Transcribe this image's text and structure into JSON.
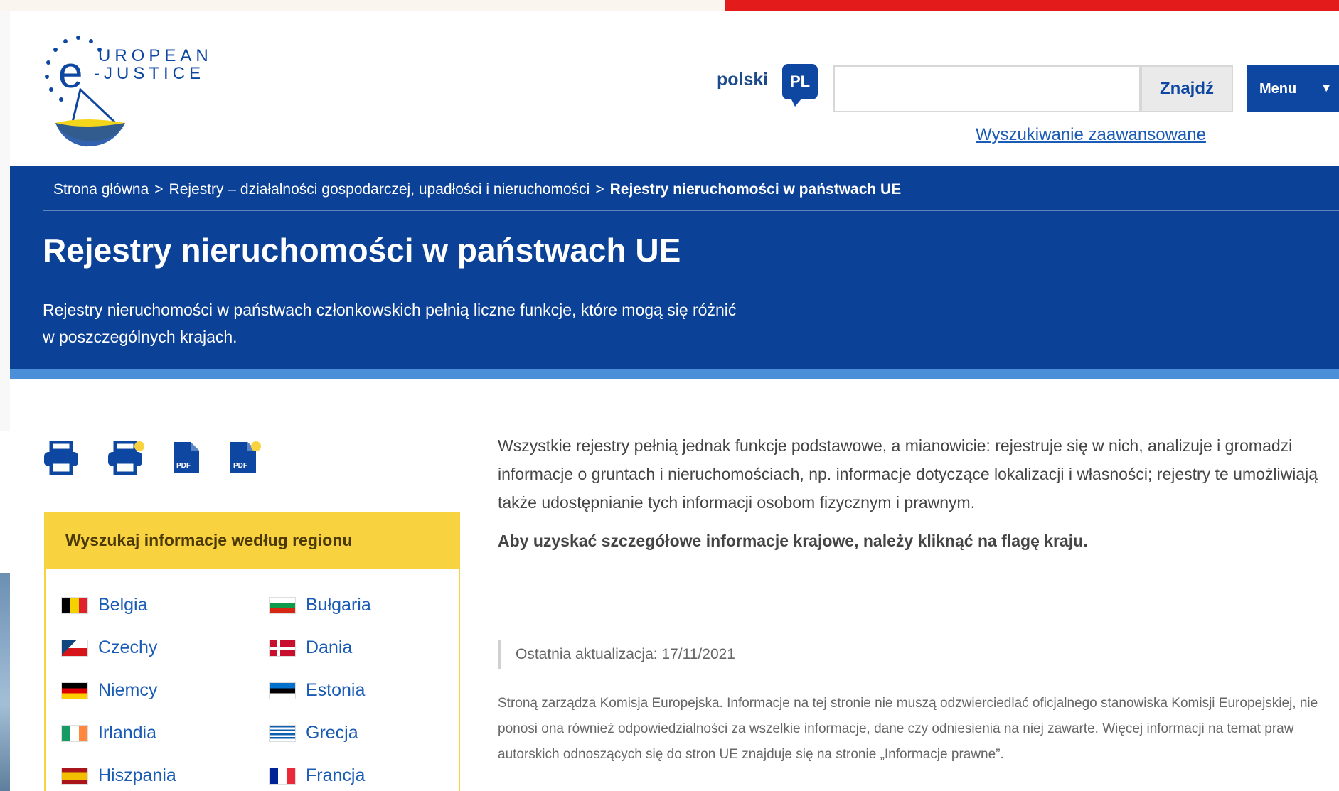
{
  "header": {
    "logo_alt": "European e-Justice",
    "logo_text_top": "UROPEAN",
    "logo_text_bottom": "-JUSTICE",
    "logo_letter": "e",
    "language_label": "polski",
    "language_code": "PL",
    "search_placeholder": "",
    "search_button": "Znajdź",
    "menu_button": "Menu",
    "menu_caret": "▼",
    "advanced_search": "Wyszukiwanie zaawansowane"
  },
  "breadcrumb": {
    "items": [
      "Strona główna",
      "Rejestry – działalności gospodarczej, upadłości i nieruchomości",
      "Rejestry nieruchomości w państwach UE"
    ],
    "separator": ">"
  },
  "page": {
    "title": "Rejestry nieruchomości w państwach UE",
    "subtitle_line1": "Rejestry nieruchomości w państwach członkowskich pełnią liczne funkcje, które mogą się różnić",
    "subtitle_line2": "w poszczególnych krajach."
  },
  "tools": {
    "print": "print-icon",
    "print_selected": "print-selection-icon",
    "pdf": "pdf-icon",
    "pdf_selected": "pdf-selection-icon"
  },
  "region": {
    "heading": "Wyszukaj informacje według regionu",
    "countries": [
      {
        "name": "Belgia",
        "colors": [
          "#000000",
          "#f6d100",
          "#e0232b"
        ],
        "dir": "v"
      },
      {
        "name": "Bułgaria",
        "colors": [
          "#ffffff",
          "#0d9b49",
          "#d62612"
        ],
        "dir": "h"
      },
      {
        "name": "Czechy",
        "colors": [
          "#ffffff",
          "#d7141a",
          "#11457e"
        ],
        "dir": "cz"
      },
      {
        "name": "Dania",
        "colors": [
          "#c8102e",
          "#ffffff"
        ],
        "dir": "dk"
      },
      {
        "name": "Niemcy",
        "colors": [
          "#000000",
          "#dd0000",
          "#ffce00"
        ],
        "dir": "h"
      },
      {
        "name": "Estonia",
        "colors": [
          "#0072ce",
          "#000000",
          "#ffffff"
        ],
        "dir": "h"
      },
      {
        "name": "Irlandia",
        "colors": [
          "#169b62",
          "#ffffff",
          "#ff883e"
        ],
        "dir": "v"
      },
      {
        "name": "Grecja",
        "colors": [
          "#0d5eaf",
          "#ffffff"
        ],
        "dir": "gr"
      },
      {
        "name": "Hiszpania",
        "colors": [
          "#aa151b",
          "#f1bf00",
          "#aa151b"
        ],
        "dir": "es"
      },
      {
        "name": "Francja",
        "colors": [
          "#002395",
          "#ffffff",
          "#ed2939"
        ],
        "dir": "v"
      }
    ]
  },
  "content": {
    "paragraph": "Wszystkie rejestry pełnią jednak funkcje podstawowe, a mianowicie: rejestruje się w nich, analizuje i gromadzi informacje o gruntach i nieruchomościach, np. informacje dotyczące lokalizacji i własności; rejestry te umożliwiają także udostępnianie tych informacji osobom fizycznym i prawnym.",
    "instruction": "Aby uzyskać szczegółowe informacje krajowe, należy kliknąć na flagę kraju.",
    "last_update": "Ostatnia aktualizacja: 17/11/2021",
    "footer": "Stroną zarządza Komisja Europejska. Informacje na tej stronie nie muszą odzwierciedlać oficjalnego stanowiska Komisji Europejskiej, nie ponosi ona również odpowiedzialności za wszelkie informacje, dane czy odniesienia na niej zawarte. Więcej informacji na temat praw autorskich odnoszących się do stron UE znajduje się na stronie „Informacje prawne”."
  },
  "colors": {
    "brand_blue": "#0b4196",
    "accent_yellow": "#f9d23f",
    "red_bar": "#e31b1b",
    "link_blue": "#1a5bb5"
  }
}
